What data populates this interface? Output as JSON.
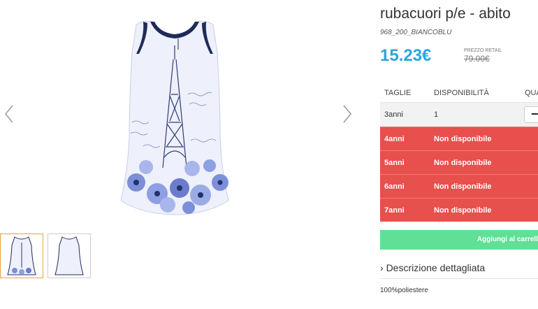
{
  "gallery": {
    "main_image": "sleeveless white dress with navy Eiffel Tower and blue daisy print",
    "prev_icon": "chevron-left-icon",
    "next_icon": "chevron-right-icon",
    "thumbnails": [
      {
        "alt": "dress front view",
        "selected": true
      },
      {
        "alt": "dress back view",
        "selected": false
      }
    ]
  },
  "product": {
    "title": "rubacuori p/e - abito",
    "sku": "968_200_BIANCOBLU",
    "price": "15.23€",
    "retail_label": "PREZZO RETAIL",
    "retail_price": "79.00€",
    "price_color": "#2aa6df"
  },
  "sizes": {
    "headers": {
      "size": "TAGLIE",
      "availability": "DISPONIBILITÀ",
      "quantity": "QUA"
    },
    "rows": [
      {
        "size": "3anni",
        "availability": "1",
        "available": true
      },
      {
        "size": "4anni",
        "availability": "Non disponibile",
        "available": false
      },
      {
        "size": "5anni",
        "availability": "Non disponibile",
        "available": false
      },
      {
        "size": "6anni",
        "availability": "Non disponibile",
        "available": false
      },
      {
        "size": "7anni",
        "availability": "Non disponibile",
        "available": false
      }
    ],
    "qty_button": "−",
    "unavailable_color": "#e8504d"
  },
  "cart": {
    "label": "Aggiungi al carrell",
    "color": "#5fe096"
  },
  "description": {
    "toggle_icon": "›",
    "toggle_label": "Descrizione dettagliata",
    "text": "100%poliestere"
  }
}
